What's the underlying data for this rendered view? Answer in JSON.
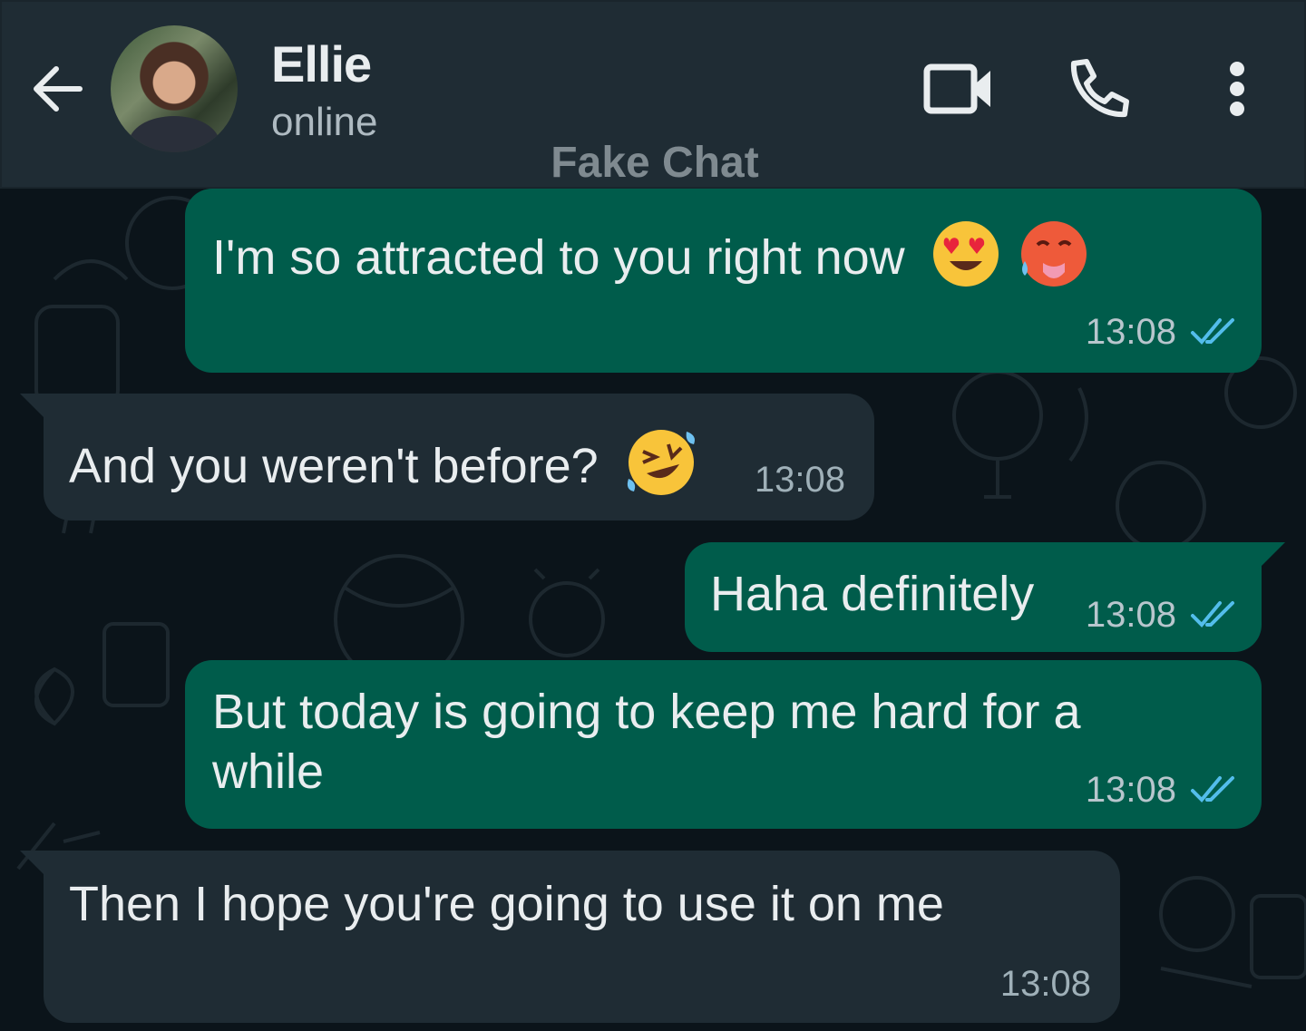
{
  "header": {
    "contact_name": "Ellie",
    "status": "online",
    "watermark": "Fake Chat",
    "icons": [
      "back-arrow-icon",
      "video-call-icon",
      "phone-icon",
      "more-vert-icon"
    ]
  },
  "messages": [
    {
      "direction": "outgoing",
      "text": "I'm so attracted to you right now",
      "emojis": [
        "heart-eyes-emoji",
        "hot-face-emoji"
      ],
      "time": "13:08",
      "status": "read"
    },
    {
      "direction": "incoming",
      "text": "And you weren't before?",
      "emojis": [
        "rolling-laughing-emoji"
      ],
      "time": "13:08"
    },
    {
      "direction": "outgoing",
      "text": "Haha definitely",
      "time": "13:08",
      "status": "read"
    },
    {
      "direction": "outgoing",
      "text_line1": "But today is going to keep me hard for a",
      "text_line2": "while",
      "time": "13:08",
      "status": "read"
    },
    {
      "direction": "incoming",
      "text": "Then I hope you're going to use it on me",
      "time": "13:08"
    }
  ],
  "colors": {
    "header_bg": "#1f2c34",
    "chat_bg": "#0b141a",
    "outgoing_bubble": "#005c4b",
    "incoming_bubble": "#1f2c34",
    "read_ticks": "#53bdeb"
  }
}
